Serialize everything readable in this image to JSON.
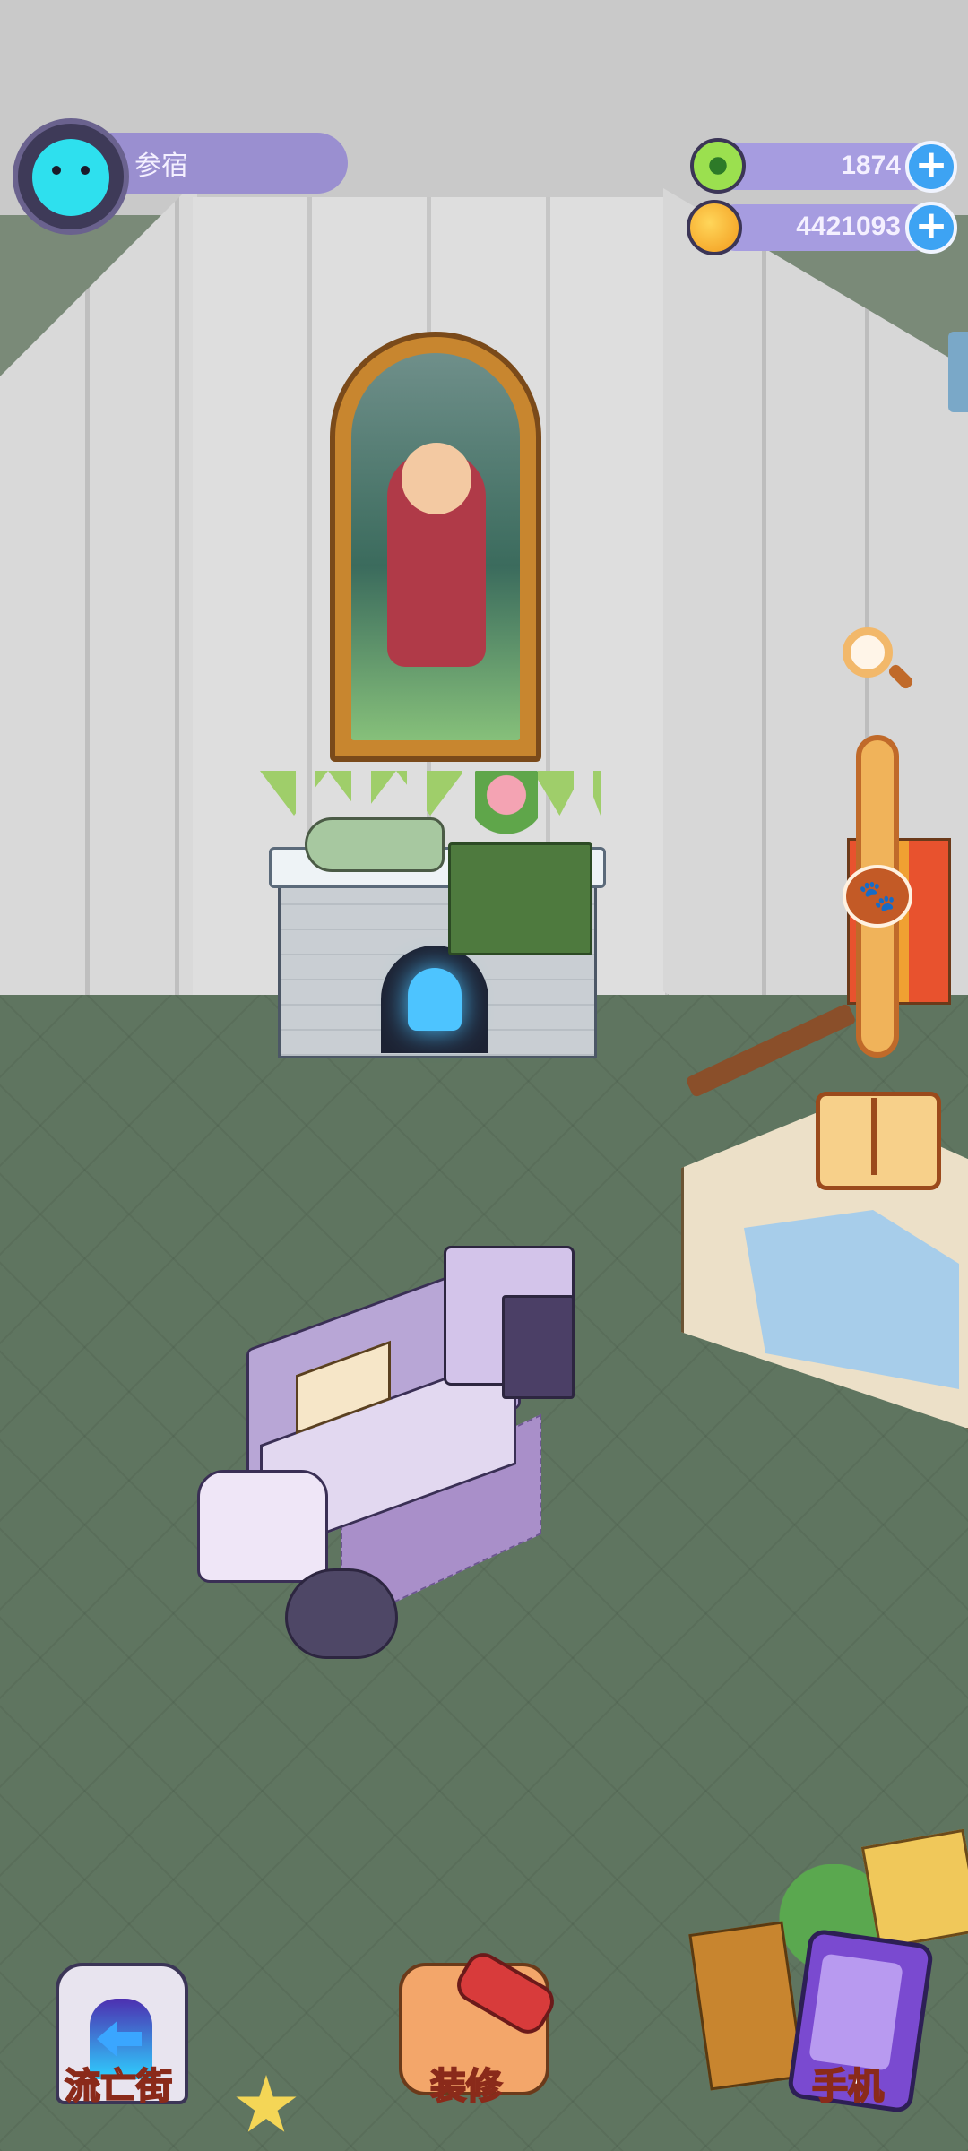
{
  "player": {
    "name": "参宿",
    "avatar_icon": "cat-face-avatar-icon"
  },
  "currencies": [
    {
      "name": "gem",
      "icon": "green-donut-gem-icon",
      "value": "1874",
      "add_label": "+"
    },
    {
      "name": "coin",
      "icon": "gold-planet-coin-icon",
      "value": "4421093",
      "add_label": "+"
    }
  ],
  "tools": {
    "zoom_icon": "magnifier-icon",
    "slider_icon": "paw-icon",
    "slider_knob_glyph": "🐾",
    "catalog_icon": "open-book-icon"
  },
  "bottom_nav": {
    "street_label": "流亡街",
    "decorate_label": "装修",
    "phone_label": "手机"
  },
  "colors": {
    "hud_bar": "#a69ce0",
    "plus_button": "#3da3f3",
    "floor": "#5f7560",
    "avatar": "#2ee0ee"
  }
}
